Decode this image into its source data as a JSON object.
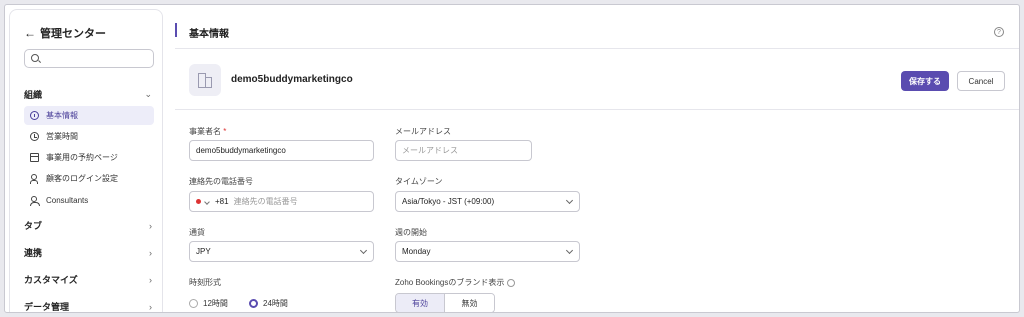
{
  "sidebar": {
    "title": "管理センター",
    "search_placeholder": "",
    "sections": {
      "org": "組織",
      "tab": "タブ",
      "integration": "連携",
      "customize": "カスタマイズ",
      "data": "データ管理"
    },
    "items": [
      {
        "label": "基本情報",
        "active": true
      },
      {
        "label": "営業時間"
      },
      {
        "label": "事業用の予約ページ"
      },
      {
        "label": "顧客のログイン設定"
      },
      {
        "label": "Consultants"
      }
    ]
  },
  "header": {
    "title": "基本情報"
  },
  "business": {
    "name": "demo5buddymarketingco",
    "save_label": "保存する",
    "cancel_label": "Cancel"
  },
  "form": {
    "business_name": {
      "label": "事業者名",
      "required_mark": "*",
      "value": "demo5buddymarketingco"
    },
    "email": {
      "label": "メールアドレス",
      "placeholder": "メールアドレス"
    },
    "phone": {
      "label": "連絡先の電話番号",
      "dial_code": "+81",
      "placeholder": "連絡先の電話番号"
    },
    "timezone": {
      "label": "タイムゾーン",
      "value": "Asia/Tokyo - JST (+09:00)"
    },
    "currency": {
      "label": "通貨",
      "value": "JPY"
    },
    "week_start": {
      "label": "週の開始",
      "value": "Monday"
    },
    "time_format": {
      "label": "時刻形式",
      "options": [
        "12時間",
        "24時間"
      ],
      "selected": "24時間"
    },
    "branding": {
      "label": "Zoho Bookingsのブランド表示",
      "options": [
        "有効",
        "無効"
      ],
      "selected": "有効"
    }
  },
  "colors": {
    "accent": "#5a4cb0",
    "active_bg": "#ededf9"
  }
}
